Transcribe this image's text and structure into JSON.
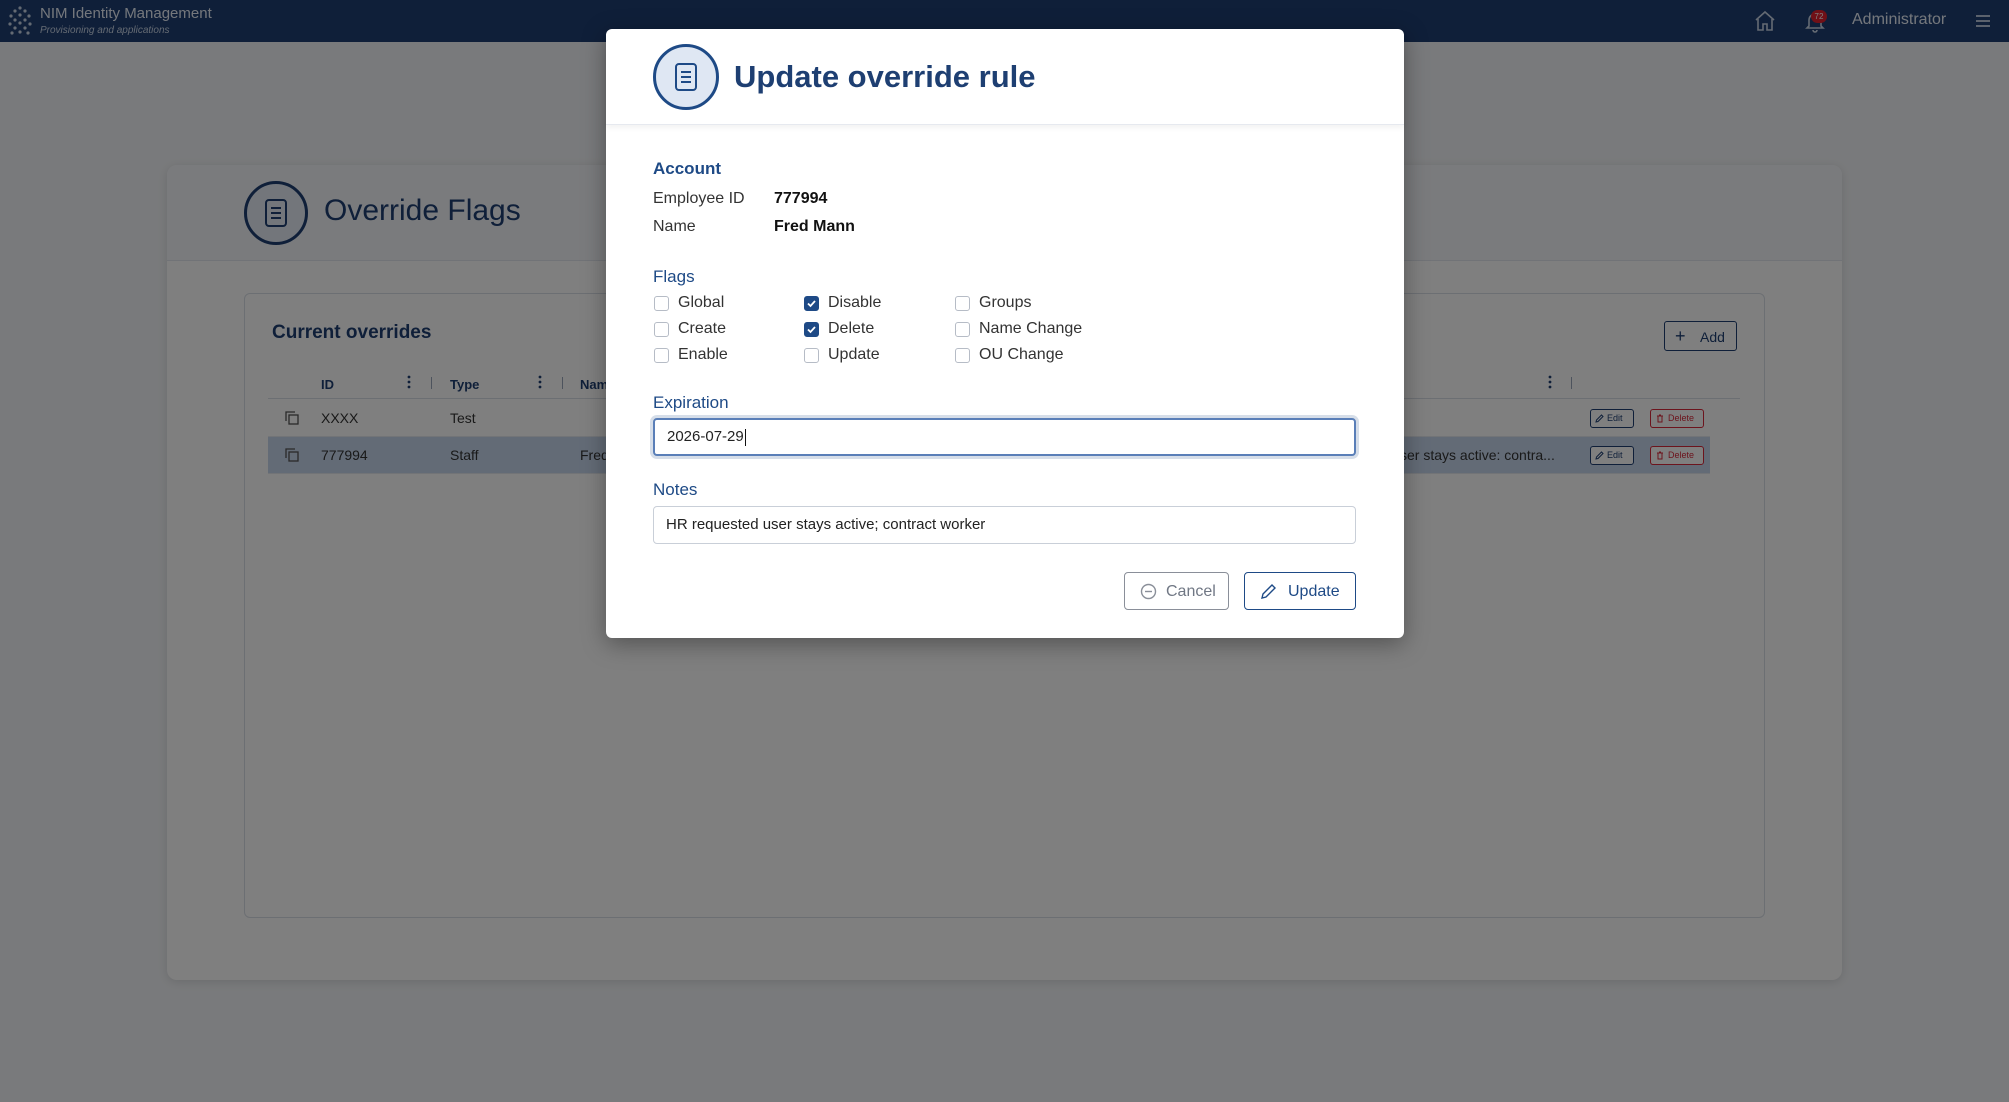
{
  "app": {
    "title": "NIM Identity Management",
    "subtitle": "Provisioning and applications",
    "notification_count": "72",
    "user": "Administrator"
  },
  "page": {
    "title": "Override Flags",
    "panel_title": "Current overrides",
    "add_label": "Add",
    "columns": [
      "ID",
      "Type",
      "Nam"
    ],
    "rows": [
      {
        "id": "XXXX",
        "type": "Test",
        "name": "",
        "notes": ""
      },
      {
        "id": "777994",
        "type": "Staff",
        "name": "Fred",
        "notes": "ser stays active: contra..."
      }
    ],
    "edit_label": "Edit",
    "delete_label": "Delete"
  },
  "modal": {
    "title": "Update override rule",
    "account_heading": "Account",
    "employee_id_label": "Employee ID",
    "employee_id": "777994",
    "name_label": "Name",
    "name": "Fred Mann",
    "flags_heading": "Flags",
    "flags": [
      {
        "label": "Global",
        "checked": false
      },
      {
        "label": "Disable",
        "checked": true
      },
      {
        "label": "Groups",
        "checked": false
      },
      {
        "label": "Create",
        "checked": false
      },
      {
        "label": "Delete",
        "checked": true
      },
      {
        "label": "Name Change",
        "checked": false
      },
      {
        "label": "Enable",
        "checked": false
      },
      {
        "label": "Update",
        "checked": false
      },
      {
        "label": "OU Change",
        "checked": false
      }
    ],
    "expiration_heading": "Expiration",
    "expiration_value": "2026-07-29",
    "notes_heading": "Notes",
    "notes_value": "HR requested user stays active; contract worker",
    "cancel_label": "Cancel",
    "update_label": "Update"
  },
  "colors": {
    "brand": "#1e3f72",
    "accent": "#1e4a86",
    "danger": "#d9293a",
    "selected_row": "#c6d6ec"
  },
  "icons": [
    "logo-icon",
    "home-icon",
    "bell-icon",
    "hamburger-menu-icon",
    "document-icon",
    "copy-icon",
    "plus-icon",
    "pencil-icon",
    "trash-icon",
    "checkmark-icon",
    "minus-circle-icon",
    "column-menu-icon"
  ]
}
